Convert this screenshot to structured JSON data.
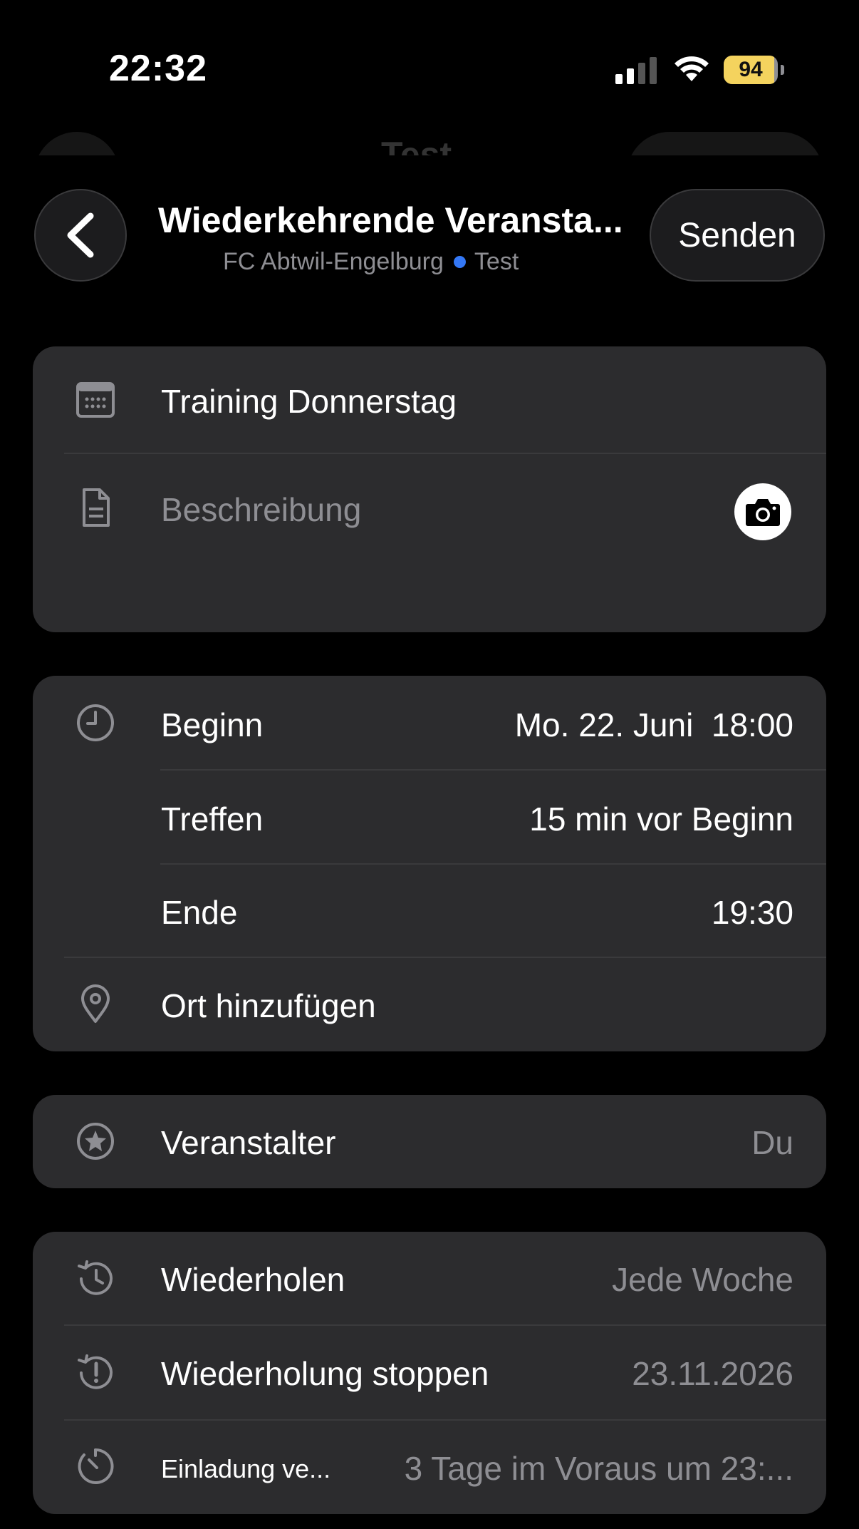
{
  "status_bar": {
    "time": "22:32",
    "battery_level": "94",
    "battery_fill_fraction": 0.94,
    "icons": [
      "signal-icon",
      "wifi-icon",
      "battery-charging-icon"
    ]
  },
  "background_sheet": {
    "title": "Test"
  },
  "nav": {
    "title": "Wiederkehrende Veransta...",
    "subtitle_team": "FC Abtwil-Engelburg",
    "subtitle_group": "Test",
    "send_label": "Senden",
    "dot_color": "#3478f6"
  },
  "event": {
    "name": "Training Donnerstag",
    "description_placeholder": "Beschreibung"
  },
  "time": {
    "start_label": "Beginn",
    "start_date": "Mo. 22. Juni",
    "start_time": "18:00",
    "meet_label": "Treffen",
    "meet_value": "15 min vor Beginn",
    "end_label": "Ende",
    "end_value": "19:30",
    "location_label": "Ort hinzufügen"
  },
  "organizer": {
    "label": "Veranstalter",
    "value": "Du"
  },
  "recurrence": {
    "repeat_label": "Wiederholen",
    "repeat_value": "Jede Woche",
    "stop_label": "Wiederholung stoppen",
    "stop_value": "23.11.2026",
    "invite_label": "Einladung ve...",
    "invite_value": "3 Tage im Voraus um 23:..."
  },
  "colors": {
    "background": "#000000",
    "card": "#2c2c2e",
    "muted_text": "#8e8e93",
    "accent_blue": "#3478f6",
    "battery_yellow": "#f4d35e"
  }
}
